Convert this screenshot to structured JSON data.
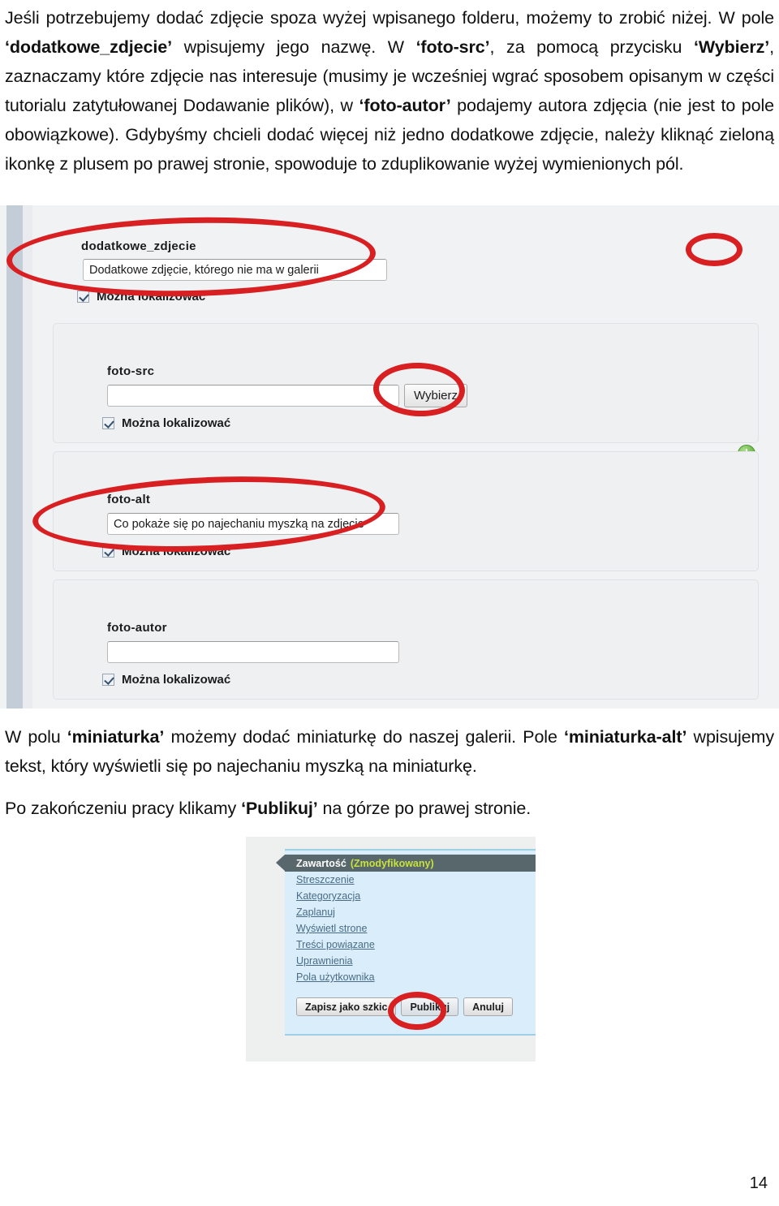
{
  "document": {
    "page_number": "14",
    "paragraphs": {
      "intro": {
        "run1": "Jeśli potrzebujemy dodać zdjęcie spoza wyżej wpisanego folderu, możemy to zrobić niżej. W pole ",
        "b1": "‘dodatkowe_zdjecie’",
        "run2": " wpisujemy jego nazwę. W ",
        "b2": "‘foto-src’",
        "run3": ", za pomocą przycisku ",
        "b3": "‘Wybierz’",
        "run4": ", zaznaczamy które zdjęcie nas interesuje (musimy je wcześniej wgrać sposobem opisanym w części tutorialu zatytułowanej Dodawanie plików), w ",
        "b4": "‘foto-autor’",
        "run5": " podajemy autora zdjęcia (nie jest to pole obowiązkowe). Gdybyśmy chcieli dodać więcej niż jedno dodatkowe zdjęcie, należy kliknąć zieloną ikonkę z plusem po prawej stronie, spowoduje to zduplikowanie wyżej wymienionych pól."
      },
      "middle": {
        "run1": "W polu ",
        "b1": "‘miniaturka’",
        "run2": " możemy dodać miniaturkę do naszej galerii. Pole ",
        "b2": "‘miniaturka-alt’",
        "run3": " wpisujemy tekst, który wyświetli się po najechaniu myszką na miniaturkę."
      },
      "bottom": {
        "run1": "Po zakończeniu pracy klikamy ",
        "b1": "‘Publikuj’",
        "run2": " na górze po prawej stronie."
      }
    }
  },
  "screenshot_form": {
    "outer_field": {
      "label": "dodatkowe_zdjecie",
      "value": "Dodatkowe zdjęcie, którego nie ma w galerii",
      "checkbox_label": "Można lokalizować",
      "checked": true
    },
    "add_button_icon": "plus-circle-green-icon",
    "subfields": [
      {
        "label": "foto-src",
        "value": "",
        "button_label": "Wybierz",
        "has_button": true,
        "checkbox_label": "Można lokalizować",
        "checked": true
      },
      {
        "label": "foto-alt",
        "value": "Co pokaże się po najechaniu myszką na zdjęcie",
        "has_button": false,
        "checkbox_label": "Można lokalizować",
        "checked": true
      },
      {
        "label": "foto-autor",
        "value": "",
        "has_button": false,
        "checkbox_label": "Można lokalizować",
        "checked": true
      }
    ],
    "annotation_color": "#d81f22"
  },
  "screenshot_menu": {
    "header": {
      "title": "Zawartość",
      "status": "(Zmodyfikowany)",
      "title_color": "#ffffff",
      "status_color": "#c7e23a",
      "bar_color": "#58676c"
    },
    "links": [
      "Streszczenie",
      "Kategoryzacja",
      "Zaplanuj",
      "Wyświetl strone",
      "Treści powiązane",
      "Uprawnienia",
      "Pola użytkownika"
    ],
    "buttons": [
      "Zapisz jako szkic",
      "Publikuj",
      "Anuluj"
    ],
    "panel_color": "#d9eefa",
    "link_color": "#4a6b85"
  }
}
